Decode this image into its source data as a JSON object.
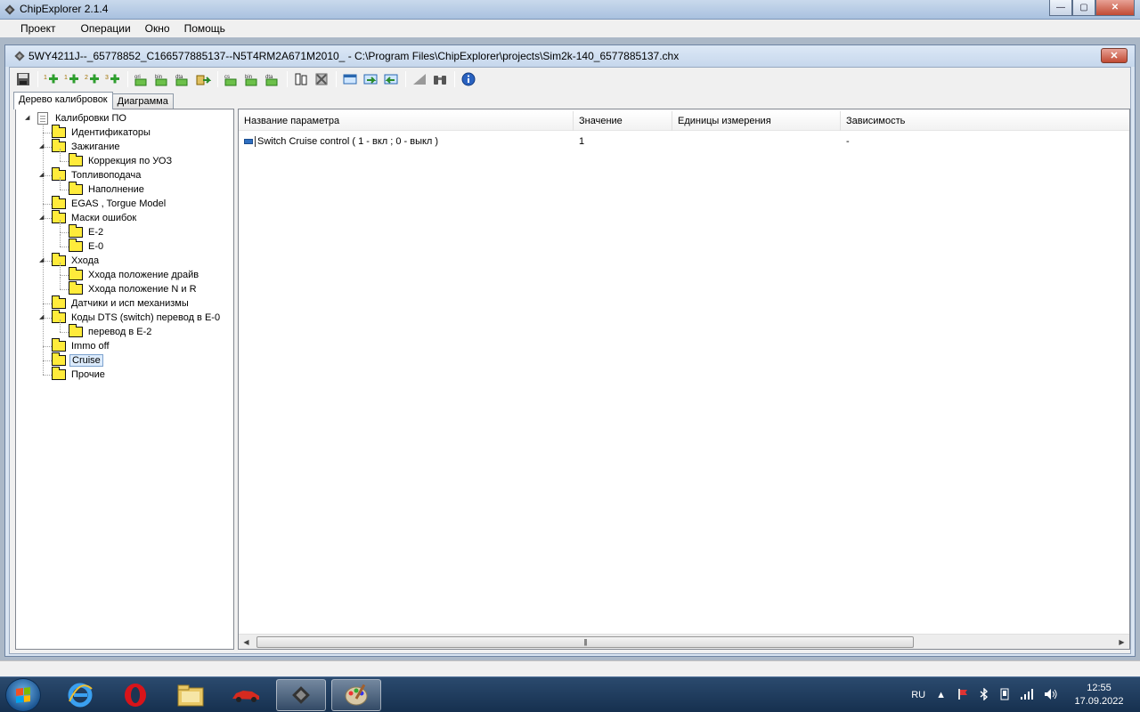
{
  "app": {
    "title": "ChipExplorer 2.1.4",
    "window_buttons": {
      "minimize": "—",
      "maximize": "▢",
      "close": "✕"
    }
  },
  "menu": [
    "Проект",
    "Операции",
    "Окно",
    "Помощь"
  ],
  "document": {
    "title": "5WY4211J--_65778852_C166577885137--N5T4RM2A671M2010_ - C:\\Program Files\\ChipExplorer\\projects\\Sim2k-140_6577885137.chx",
    "close": "✕"
  },
  "toolbar": {
    "icons": [
      "save-icon",
      "add-1-icon",
      "add-2-icon",
      "add-3-icon",
      "ori-file-icon",
      "bin-file-icon",
      "dta-file-icon",
      "export-icon",
      "checksum-icon",
      "save-bin-icon",
      "save-dta-icon",
      "compare-icon",
      "delete-compare-icon",
      "window-1-icon",
      "window-2-icon",
      "window-3-icon",
      "triangle-icon",
      "binoculars-icon",
      "info-icon"
    ]
  },
  "tabs": [
    "Дерево калибровок",
    "Диаграмма"
  ],
  "tree": {
    "root": "Калибровки ПО",
    "items": [
      {
        "label": "Идентификаторы",
        "level": 1,
        "expander": ""
      },
      {
        "label": "Зажигание",
        "level": 1,
        "expander": "◢"
      },
      {
        "label": "Коррекция по УОЗ",
        "level": 2,
        "expander": ""
      },
      {
        "label": "Топливоподача",
        "level": 1,
        "expander": "◢"
      },
      {
        "label": "Наполнение",
        "level": 2,
        "expander": ""
      },
      {
        "label": "EGAS , Torgue Model",
        "level": 1,
        "expander": ""
      },
      {
        "label": "Маски ошибок",
        "level": 1,
        "expander": "◢"
      },
      {
        "label": "E-2",
        "level": 2,
        "expander": ""
      },
      {
        "label": "E-0",
        "level": 2,
        "expander": ""
      },
      {
        "label": "Ххода",
        "level": 1,
        "expander": "◢"
      },
      {
        "label": "Ххода положение драйв",
        "level": 2,
        "expander": ""
      },
      {
        "label": "Ххода положение N и R",
        "level": 2,
        "expander": ""
      },
      {
        "label": "Датчики и исп механизмы",
        "level": 1,
        "expander": ""
      },
      {
        "label": "Коды DTS (switch) перевод в E-0",
        "level": 1,
        "expander": "◢"
      },
      {
        "label": "перевод в E-2",
        "level": 2,
        "expander": ""
      },
      {
        "label": "Immo off",
        "level": 1,
        "expander": ""
      },
      {
        "label": "Cruise",
        "level": 1,
        "expander": "",
        "selected": true
      },
      {
        "label": "Прочие",
        "level": 1,
        "expander": ""
      }
    ]
  },
  "table": {
    "columns": [
      "Название параметра",
      "Значение",
      "Единицы измерения",
      "Зависимость"
    ],
    "rows": [
      {
        "name": "Switch Cruise control  ( 1 - вкл ; 0 - выкл )",
        "value": "1",
        "units": "",
        "dependency": "-"
      }
    ]
  },
  "scrollbar": {
    "left_arrow": "◀",
    "right_arrow": "▶",
    "grip": "|||"
  },
  "taskbar": {
    "apps": [
      "ie-icon",
      "opera-icon",
      "explorer-icon",
      "car-app-icon",
      "chip-app-icon",
      "paint-icon"
    ],
    "language": "RU",
    "tray_arrow": "▲",
    "time": "12:55",
    "date": "17.09.2022"
  }
}
